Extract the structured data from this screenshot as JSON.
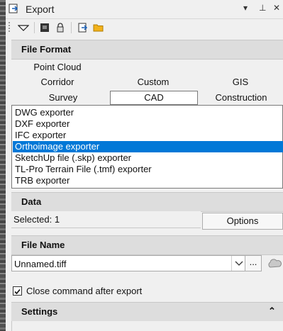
{
  "window": {
    "title": "Export",
    "pin_glyph": "▾",
    "dock_glyph": "⊥",
    "close_glyph": "✕"
  },
  "file_format": {
    "header": "File Format",
    "tabs_row1": [
      "Point Cloud"
    ],
    "tabs_row2": [
      "Corridor",
      "Custom",
      "GIS"
    ],
    "tabs_row3": [
      "Survey",
      "CAD",
      "Construction"
    ],
    "selected_tab": "CAD"
  },
  "exporters": [
    "DWG exporter",
    "DXF exporter",
    "IFC exporter",
    "Orthoimage exporter",
    "SketchUp file (.skp) exporter",
    "TL-Pro Terrain File (.tmf) exporter",
    "TRB exporter"
  ],
  "selected_exporter_index": 3,
  "data_section": {
    "header": "Data",
    "selected_label": "Selected: 1",
    "options_label": "Options"
  },
  "file_name": {
    "header": "File Name",
    "value": "Unnamed.tiff",
    "browse_label": "..."
  },
  "close_command": {
    "label": "Close command after export",
    "checked": true
  },
  "settings": {
    "header": "Settings",
    "collapse_glyph": "⌃"
  }
}
